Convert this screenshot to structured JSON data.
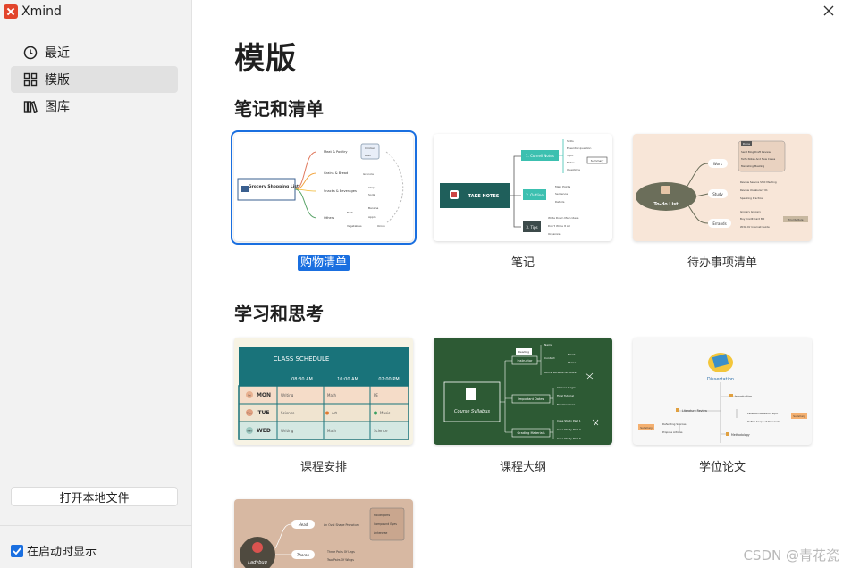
{
  "app": {
    "name": "Xmind"
  },
  "sidebar": {
    "items": [
      {
        "label": "最近",
        "icon": "clock-icon"
      },
      {
        "label": "模版",
        "icon": "grid-icon",
        "active": true
      },
      {
        "label": "图库",
        "icon": "library-icon"
      }
    ],
    "open_local_label": "打开本地文件",
    "show_on_startup_label": "在启动时显示",
    "show_on_startup_checked": true
  },
  "main": {
    "title": "模版",
    "sections": [
      {
        "title": "笔记和清单",
        "cards": [
          {
            "label": "购物清单",
            "selected": true,
            "thumb": {
              "center": "Grocery Shopping List",
              "b1": "Meat & Poultry",
              "b2": "Grains & Bread",
              "b3": "Snacks & Beverages",
              "b4": "Others",
              "s1": "Chicken",
              "s2": "Beef",
              "s3": "Granola",
              "s4": "Chips",
              "s5": "Soda",
              "s6": "Fruit",
              "s7": "Banana",
              "s8": "Apple",
              "s9": "Vegetables",
              "s10": "Onion"
            }
          },
          {
            "label": "笔记",
            "thumb": {
              "center": "TAKE NOTES",
              "b1": "1. Cornell Notes",
              "b2": "2. Outline",
              "b3": "3. Tips",
              "s1": "Skills",
              "s2": "Essential question",
              "s3": "Topic",
              "s4": "Notes",
              "s5": "Questions",
              "s6": "Summary",
              "s7": "Main Points",
              "s8": "Sentence",
              "s9": "Details",
              "s10": "Write Down Main Ideas",
              "s11": "Don't Write It All",
              "s12": "Organize"
            }
          },
          {
            "label": "待办事项清单",
            "thumb": {
              "center": "To-do List",
              "b1": "Work",
              "b2": "Study",
              "b3": "Errands",
              "s0": "Done",
              "s1": "Send Blog Draft Review",
              "s2": "Tell's Notes And New Cases",
              "s3": "Marketing Meeting",
              "s4": "Review Service Shot Meeting",
              "s5": "Review Vocabulary 01",
              "s6": "Speaking Practice",
              "s7": "Grocery Grocery",
              "s8": "Buy Credit Card Bill",
              "s9": "Write Dr Internet Guide",
              "s10": "Priority Rule"
            }
          }
        ]
      },
      {
        "title": "学习和思考",
        "cards": [
          {
            "label": "课程安排",
            "thumb": {
              "title": "CLASS SCHEDULE",
              "times": [
                "08:30 AM",
                "10:00 AM",
                "02:00 PM"
              ],
              "rows": [
                {
                  "badge": "Fri",
                  "day": "MON",
                  "c1": "Writing",
                  "c2": "Math",
                  "c3": "PE"
                },
                {
                  "badge": "Mon",
                  "day": "TUE",
                  "c1": "Science",
                  "c2": "Art",
                  "c3": "Music"
                },
                {
                  "badge": "Wed",
                  "day": "WED",
                  "c1": "Writing",
                  "c2": "Math",
                  "c3": "Science"
                }
              ]
            }
          },
          {
            "label": "课程大纲",
            "thumb": {
              "center": "Course Syllabus",
              "b1": "Instructor",
              "b2": "Important Dates",
              "b3": "Grading Materials",
              "b0": "Reading",
              "s1": "Name",
              "s2": "Contact",
              "s3": "Email",
              "s4": "Phone",
              "s5": "Office Location & Hours",
              "s6": "Classes Begin",
              "s7": "Final Tutorial",
              "s8": "Examinations",
              "s9": "Case Study Part 1",
              "s10": "Case Study Part 2",
              "s11": "Case Study Part 3"
            }
          },
          {
            "label": "学位论文",
            "thumb": {
              "center": "Dissertation",
              "b1": "Literature Review",
              "b2": "Introduction",
              "b3": "Methodology",
              "s1": "Defending Sources",
              "s2": "Propose Articles",
              "s3": "Establish Research Topic",
              "s4": "Define Scope of Research",
              "s5": "Summary",
              "s6": "Summary"
            }
          }
        ]
      },
      {
        "title": "",
        "cards": [
          {
            "label": "",
            "thumb": {
              "center": "Ladybug",
              "b1": "Head",
              "b2": "Thorax",
              "s1": "An Oval Shape Pronotum",
              "s2": "Mouthparts",
              "s3": "Compound Eyes",
              "s4": "Antennae",
              "s5": "Three Pairs Of Legs",
              "s6": "Two Pairs Of Wings"
            }
          }
        ]
      }
    ]
  },
  "watermark": "CSDN @青花瓷",
  "colors": {
    "accent": "#1a6fe0",
    "sidebar_bg": "#f2f2f2",
    "schedule_header": "#19737a",
    "syllabus_bg": "#2d5a34"
  }
}
